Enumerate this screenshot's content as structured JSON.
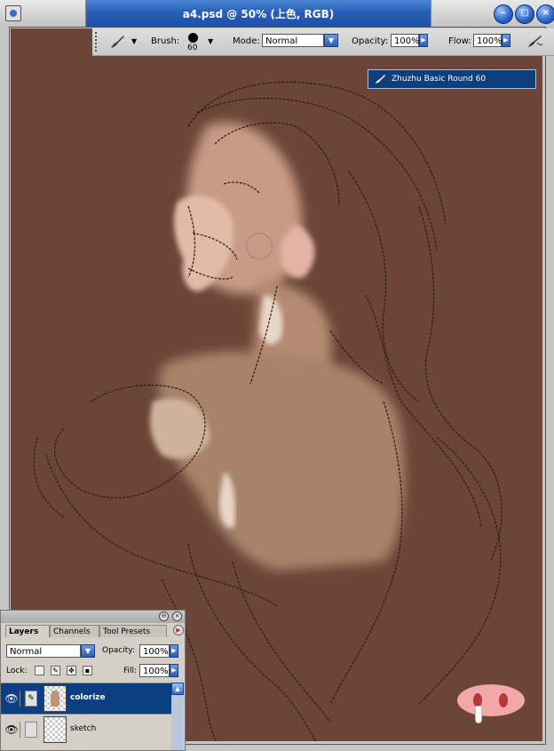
{
  "window": {
    "title": "a4.psd @ 50% (上色, RGB)",
    "buttons": [
      "minimize",
      "maximize",
      "close"
    ]
  },
  "options_bar": {
    "brush_label": "Brush:",
    "brush_size": "60",
    "mode_label": "Mode:",
    "mode_value": "Normal",
    "opacity_label": "Opacity:",
    "opacity_value": "100%",
    "flow_label": "Flow:",
    "flow_value": "100%"
  },
  "brush_tooltip": "Zhuzhu Basic Round 60",
  "canvas": {
    "background_color": "#6b4638"
  },
  "layers_panel": {
    "tabs": [
      {
        "label": "Layers",
        "active": true
      },
      {
        "label": "Channels",
        "active": false
      },
      {
        "label": "Tool Presets",
        "active": false
      }
    ],
    "blend_mode": "Normal",
    "opacity_label": "Opacity:",
    "opacity_value": "100%",
    "lock_label": "Lock:",
    "fill_label": "Fill:",
    "fill_value": "100%",
    "layers": [
      {
        "name": "colorize",
        "selected": true,
        "visible": true
      },
      {
        "name": "sketch",
        "selected": false,
        "visible": true
      }
    ]
  },
  "colors": {
    "title_bar": "#2a5fb8",
    "selected_layer": "#0b3e82",
    "canvas": "#6b4638"
  }
}
